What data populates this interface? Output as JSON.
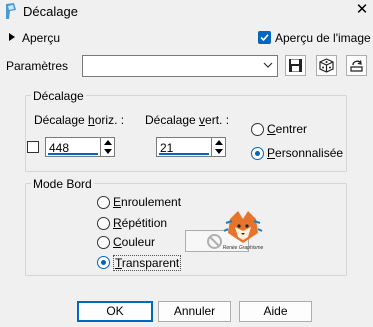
{
  "window": {
    "title": "Décalage",
    "close_icon": "close-icon",
    "app_icon": "paint-shop-pro-icon"
  },
  "preview": {
    "label": "Aperçu",
    "toggle_label": "Aperçu de l'image",
    "checked": true
  },
  "params": {
    "label": "Paramètres",
    "value": ""
  },
  "offset_group": {
    "legend": "Décalage",
    "horiz_label_pre": "Décalage ",
    "horiz_label_ul": "h",
    "horiz_label_post": "oriz. :",
    "horiz_value": "448",
    "vert_label_pre": "Décalage ",
    "vert_label_ul": "v",
    "vert_label_post": "ert. :",
    "vert_value": "21",
    "center_ul": "C",
    "center_rest": "entrer",
    "custom_ul": "P",
    "custom_rest": "ersonnalisée",
    "selected": "custom"
  },
  "edge_group": {
    "legend": "Mode Bord",
    "options": [
      {
        "ul": "E",
        "rest": "nroulement"
      },
      {
        "ul": "R",
        "rest": "épétition"
      },
      {
        "ul": "C",
        "rest": "ouleur"
      },
      {
        "ul": "T",
        "rest": "ransparent"
      }
    ],
    "selected": "Transparent",
    "watermark_text": "Renée Graphisme"
  },
  "buttons": {
    "ok": "OK",
    "cancel": "Annuler",
    "help": "Aide"
  },
  "colors": {
    "accent": "#0067c0"
  }
}
